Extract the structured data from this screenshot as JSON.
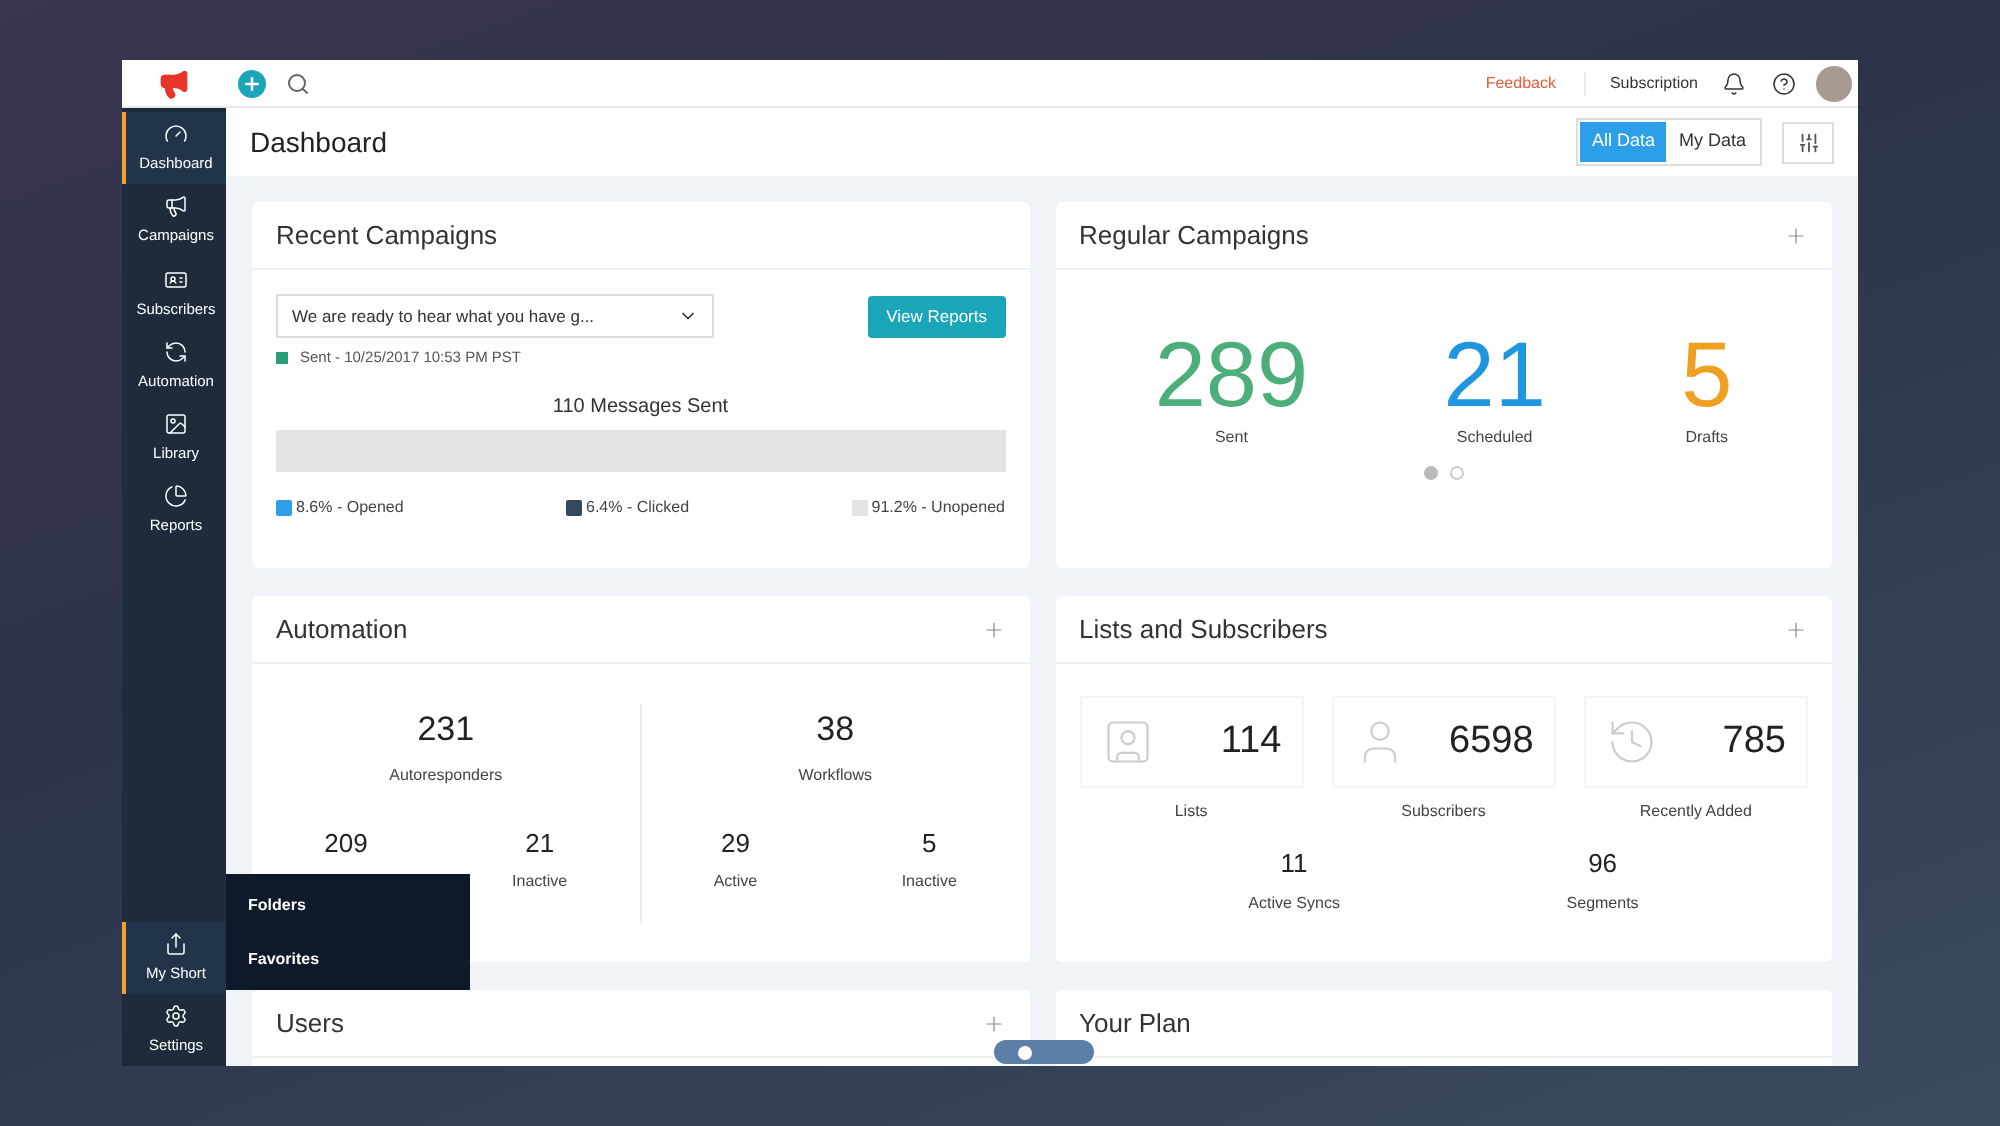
{
  "topbar": {
    "feedback": "Feedback",
    "subscription": "Subscription"
  },
  "sidebar": {
    "items": [
      {
        "label": "Dashboard",
        "selected": true
      },
      {
        "label": "Campaigns",
        "selected": false
      },
      {
        "label": "Subscribers",
        "selected": false
      },
      {
        "label": "Automation",
        "selected": false
      },
      {
        "label": "Library",
        "selected": false
      },
      {
        "label": "Reports",
        "selected": false
      }
    ],
    "bottom": [
      {
        "label": "My Short",
        "selected": true
      },
      {
        "label": "Settings",
        "selected": false
      }
    ]
  },
  "popup_menu": [
    "Folders",
    "Favorites"
  ],
  "header": {
    "title": "Dashboard",
    "toggle": [
      {
        "label": "All Data",
        "selected": true
      },
      {
        "label": "My Data",
        "selected": false
      }
    ]
  },
  "recent_campaigns": {
    "title": "Recent Campaigns",
    "campaign": "We are ready to hear what you have g...",
    "button": "View Reports",
    "status": "Sent - 10/25/2017 10:53 PM PST",
    "messages": "110 Messages Sent",
    "legend": [
      {
        "label": "8.6% - Opened",
        "color": "#2d9ee8"
      },
      {
        "label": "6.4% - Clicked",
        "color": "#34495e"
      },
      {
        "label": "91.2% - Unopened",
        "color": "#e3e4e6"
      }
    ]
  },
  "regular_campaigns": {
    "title": "Regular Campaigns",
    "stats": [
      {
        "value": "289",
        "label": "Sent",
        "color": "#4caf7a"
      },
      {
        "value": "21",
        "label": "Scheduled",
        "color": "#2196e0"
      },
      {
        "value": "5",
        "label": "Drafts",
        "color": "#f0a020"
      }
    ],
    "pager": [
      {
        "selected": true
      },
      {
        "selected": false
      }
    ]
  },
  "automation": {
    "title": "Automation",
    "groups": [
      {
        "value": "231",
        "label": "Autoresponders",
        "sub": [
          {
            "value": "209"
          },
          {
            "value": "21",
            "label": "Inactive"
          }
        ]
      },
      {
        "value": "38",
        "label": "Workflows",
        "sub": [
          {
            "value": "29",
            "label": "Active"
          },
          {
            "value": "5",
            "label": "Inactive"
          }
        ]
      }
    ]
  },
  "lists": {
    "title": "Lists and Subscribers",
    "tiles": [
      {
        "value": "114",
        "label": "Lists"
      },
      {
        "value": "6598",
        "label": "Subscribers"
      },
      {
        "value": "785",
        "label": "Recently Added"
      }
    ],
    "more": [
      {
        "value": "11",
        "label": "Active Syncs"
      },
      {
        "value": "96",
        "label": "Segments"
      }
    ]
  },
  "users": {
    "title": "Users"
  },
  "your_plan": {
    "title": "Your Plan"
  }
}
